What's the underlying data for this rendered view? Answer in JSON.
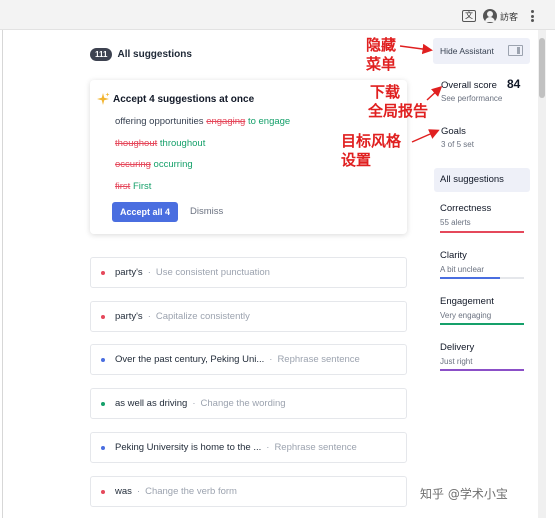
{
  "browser": {
    "translate_glyph": "文",
    "guest_label": "訪客"
  },
  "header": {
    "count": "111",
    "title": "All suggestions"
  },
  "accept_card": {
    "title": "Accept 4 suggestions at once",
    "lines": [
      {
        "prefix": "offering opportunities ",
        "removed": "engaging",
        "added": " to engage"
      },
      {
        "prefix": "",
        "removed": "thoughout",
        "added": " throughout"
      },
      {
        "prefix": "",
        "removed": "occuring",
        "added": " occurring"
      },
      {
        "prefix": "",
        "removed": "first",
        "added": " First"
      }
    ],
    "accept_label": "Accept all 4",
    "dismiss_label": "Dismiss"
  },
  "suggestions": [
    {
      "text": "party's",
      "hint": "Use consistent punctuation",
      "dot_color": "#e5485b"
    },
    {
      "text": "party's",
      "hint": "Capitalize consistently",
      "dot_color": "#e5485b"
    },
    {
      "text": "Over the past century, Peking Uni...",
      "hint": "Rephrase sentence",
      "dot_color": "#4a6ee0"
    },
    {
      "text": "as well as driving",
      "hint": "Change the wording",
      "dot_color": "#15a06a"
    },
    {
      "text": "Peking University is home to the ...",
      "hint": "Rephrase sentence",
      "dot_color": "#4a6ee0"
    },
    {
      "text": "was",
      "hint": "Change the verb form",
      "dot_color": "#e5485b"
    }
  ],
  "sidebar": {
    "hide_assistant": "Hide Assistant",
    "overall_score_label": "Overall score",
    "overall_score_value": "84",
    "overall_score_sub": "See performance",
    "goals_label": "Goals",
    "goals_sub": "3 of 5 set",
    "all_suggestions": "All suggestions",
    "categories": [
      {
        "name": "Correctness",
        "sub": "55 alerts",
        "color": "#e5485b",
        "fill": 1.0
      },
      {
        "name": "Clarity",
        "sub": "A bit unclear",
        "color": "#4a6ee0",
        "fill": 0.72
      },
      {
        "name": "Engagement",
        "sub": "Very engaging",
        "color": "#15a06a",
        "fill": 1.0
      },
      {
        "name": "Delivery",
        "sub": "Just right",
        "color": "#8b4fc7",
        "fill": 1.0
      }
    ]
  },
  "annotations": {
    "hide_menu": [
      "隐藏",
      "菜单"
    ],
    "download_report": [
      "下载",
      "全局报告"
    ],
    "goal_style": [
      "目标风格",
      "设置"
    ]
  },
  "watermark": "知乎 @学术小宝"
}
